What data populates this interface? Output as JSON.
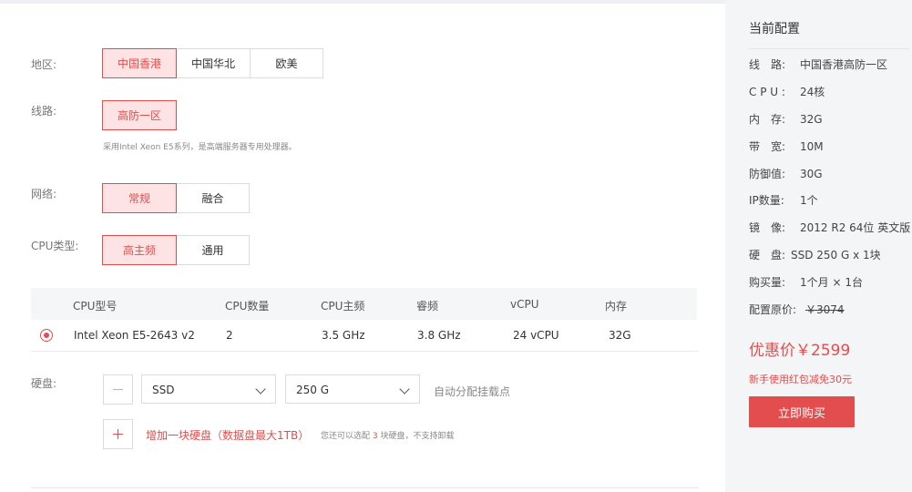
{
  "form": {
    "region": {
      "label": "地区:",
      "options": [
        "中国香港",
        "中国华北",
        "欧美"
      ]
    },
    "line": {
      "label": "线路:",
      "options": [
        "高防一区"
      ],
      "hint": "采用Intel Xeon E5系列，是高端服务器专用处理器。"
    },
    "network": {
      "label": "网络:",
      "options": [
        "常规",
        "融合"
      ]
    },
    "cpu_type": {
      "label": "CPU类型:",
      "options": [
        "高主频",
        "通用"
      ]
    },
    "table": {
      "headers": [
        "CPU型号",
        "CPU数量",
        "CPU主频",
        "睿频",
        "vCPU",
        "内存"
      ],
      "row": [
        "Intel Xeon E5-2643 v2",
        "2",
        "3.5 GHz",
        "3.8 GHz",
        "24 vCPU",
        "32G"
      ]
    },
    "disk": {
      "label": "硬盘:",
      "type_value": "SSD",
      "size_value": "250 G",
      "auto_mount": "自动分配挂载点",
      "add_label": "增加一块硬盘（数据盘最大1TB）",
      "note_prefix": "您还可以选配",
      "note_count": "3",
      "note_suffix": "块硬盘，不支持卸载"
    }
  },
  "summary": {
    "title": "当前配置",
    "rows": [
      {
        "k": "线　路:",
        "v": "中国香港高防一区"
      },
      {
        "k": "C P U :",
        "v": "24核"
      },
      {
        "k": "内　存:",
        "v": "32G"
      },
      {
        "k": "带　宽:",
        "v": "10M"
      },
      {
        "k": "防御值:",
        "v": "30G"
      },
      {
        "k": "IP数量:",
        "v": "1个"
      },
      {
        "k": "镜　像:",
        "v": "2012 R2 64位 英文版"
      },
      {
        "k": "硬　盘:",
        "v": "SSD  250 G x 1块"
      },
      {
        "k": "购买量:",
        "v": "1个月 × 1台"
      },
      {
        "k": "配置原价:",
        "v": "￥3074"
      }
    ],
    "price": "优惠价￥2599",
    "promo": "新手使用红包减免30元",
    "buy": "立即购买"
  },
  "colors": {
    "accent": "#e34d4d",
    "accent_light": "#fde3e3",
    "sidebar_bg": "#f3f5f7"
  },
  "icons": {
    "selected_radio": "radio-selected-icon",
    "minus": "minus-icon",
    "plus": "plus-icon",
    "dropdown": "chevron-down-icon"
  }
}
